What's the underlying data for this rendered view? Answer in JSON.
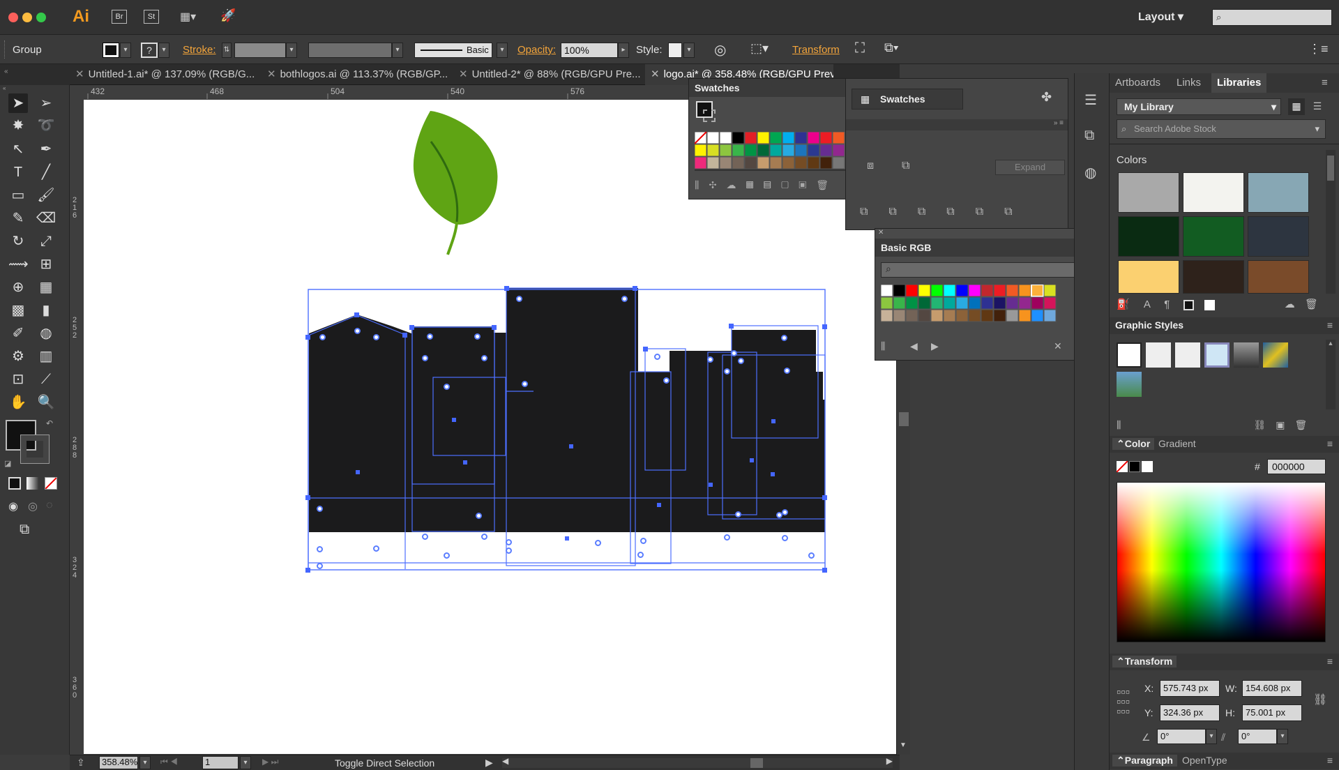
{
  "app": {
    "logo": "Ai",
    "btn_br": "Br",
    "btn_st": "St",
    "workspace": "Layout"
  },
  "colors": {
    "accent_orange": "#f39a1f",
    "selection": "#4d6fff",
    "leaf": "#5fa414",
    "building": "#1b1b1c"
  },
  "control_bar": {
    "selection_label": "Group",
    "stroke_label": "Stroke:",
    "stroke_style": "Basic",
    "opacity_label": "Opacity:",
    "opacity_value": "100%",
    "style_label": "Style:",
    "transform_label": "Transform"
  },
  "tabs": [
    {
      "label": "Untitled-1.ai* @ 137.09% (RGB/G..."
    },
    {
      "label": "bothlogos.ai @ 113.37% (RGB/GP..."
    },
    {
      "label": "Untitled-2* @ 88% (RGB/GPU Pre..."
    },
    {
      "label": "logo.ai* @ 358.48% (RGB/GPU Preview)"
    }
  ],
  "ruler": {
    "h_ticks": [
      "432",
      "468",
      "504",
      "540",
      "576"
    ],
    "v_ticks": [
      "216",
      "252",
      "288",
      "324",
      "360"
    ]
  },
  "swatches_panel": {
    "title": "Swatches"
  },
  "mid_panel": {
    "title": "Swatches",
    "expand": "Expand"
  },
  "basic_rgb": {
    "title": "Basic RGB"
  },
  "libraries": {
    "tabs": [
      "Artboards",
      "Links",
      "Libraries"
    ],
    "library_name": "My Library",
    "search_placeholder": "Search Adobe Stock",
    "colors_label": "Colors",
    "colors": [
      "#a9a9a9",
      "#f3f3ef",
      "#87a7b4",
      "#0a2b12",
      "#125c22",
      "#2d3540",
      "#fbd070",
      "#2e221b",
      "#7a4b2a"
    ]
  },
  "graphic_styles": {
    "title": "Graphic Styles"
  },
  "color_panel": {
    "tabs": [
      "Color",
      "Gradient"
    ],
    "hex_label": "#",
    "hex": "000000"
  },
  "transform": {
    "title": "Transform",
    "x_label": "X:",
    "x": "575.743 px",
    "y_label": "Y:",
    "y": "324.36 px",
    "w_label": "W:",
    "w": "154.608 px",
    "h_label": "H:",
    "h": "75.001 px",
    "rotate": "0°",
    "shear": "0°"
  },
  "bottom_tabs": [
    "Paragraph",
    "OpenType"
  ],
  "status": {
    "zoom": "358.48%",
    "page": "1",
    "tool": "Toggle Direct Selection"
  }
}
